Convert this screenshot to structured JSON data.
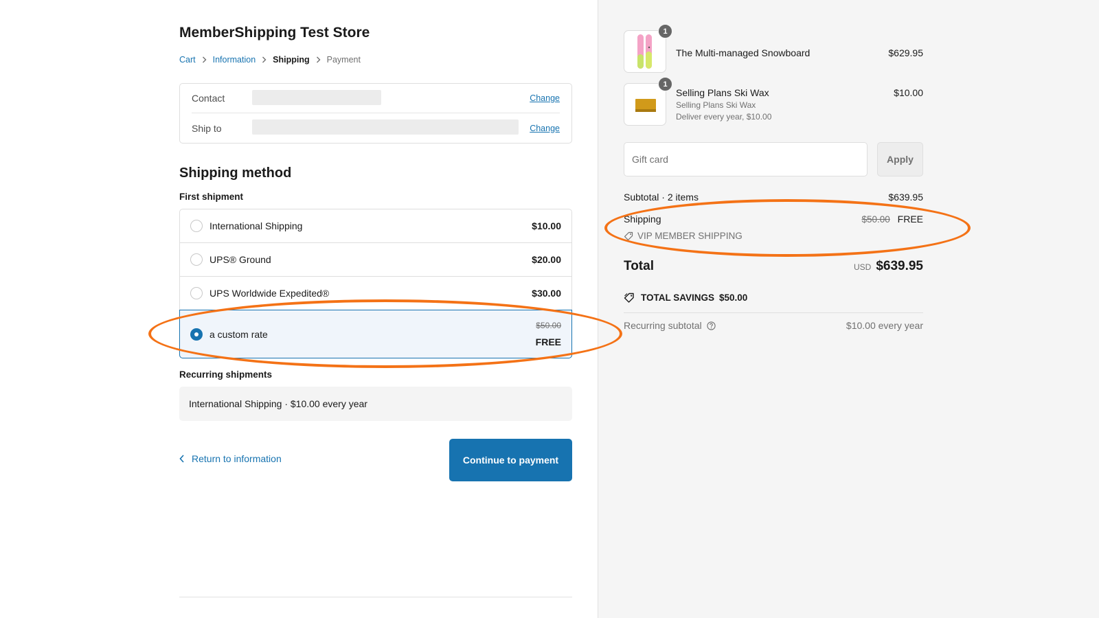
{
  "store": {
    "name": "MemberShipping Test Store"
  },
  "breadcrumb": {
    "items": [
      {
        "label": "Cart",
        "state": "link"
      },
      {
        "label": "Information",
        "state": "link"
      },
      {
        "label": "Shipping",
        "state": "current"
      },
      {
        "label": "Payment",
        "state": "future"
      }
    ]
  },
  "review": {
    "contact_label": "Contact",
    "contact_value": "",
    "ship_label": "Ship to",
    "ship_value": "",
    "change_label": "Change"
  },
  "shipping": {
    "title": "Shipping method",
    "first_shipment_label": "First shipment",
    "methods": [
      {
        "name": "International Shipping",
        "price": "$10.00",
        "selected": false
      },
      {
        "name": "UPS® Ground",
        "price": "$20.00",
        "selected": false
      },
      {
        "name": "UPS Worldwide Expedited®",
        "price": "$30.00",
        "selected": false
      },
      {
        "name": "a custom rate",
        "original_price": "$50.00",
        "price": "FREE",
        "selected": true
      }
    ],
    "recurring_label": "Recurring shipments",
    "recurring_value": "International Shipping · $10.00 every year"
  },
  "actions": {
    "return_label": "Return to information",
    "continue_label": "Continue to payment"
  },
  "order": {
    "items": [
      {
        "name": "The Multi-managed Snowboard",
        "price": "$629.95",
        "qty": "1",
        "icon": "snowboard-image"
      },
      {
        "name": "Selling Plans Ski Wax",
        "variant": "Selling Plans Ski Wax",
        "plan": "Deliver every year, $10.00",
        "price": "$10.00",
        "qty": "1",
        "icon": "ski-wax-image"
      }
    ],
    "gift_card_placeholder": "Gift card",
    "apply_label": "Apply",
    "subtotal_label": "Subtotal · 2 items",
    "subtotal_value": "$639.95",
    "shipping_label": "Shipping",
    "shipping_original": "$50.00",
    "shipping_value": "FREE",
    "discount_name": "VIP MEMBER SHIPPING",
    "total_label": "Total",
    "currency": "USD",
    "total_value": "$639.95",
    "savings_label": "TOTAL SAVINGS",
    "savings_value": "$50.00",
    "recurring_subtotal_label": "Recurring subtotal",
    "recurring_subtotal_value": "$10.00 every year"
  },
  "colors": {
    "accent": "#1773b0",
    "annotation": "#f47216",
    "sidebar_bg": "#f5f5f5"
  }
}
